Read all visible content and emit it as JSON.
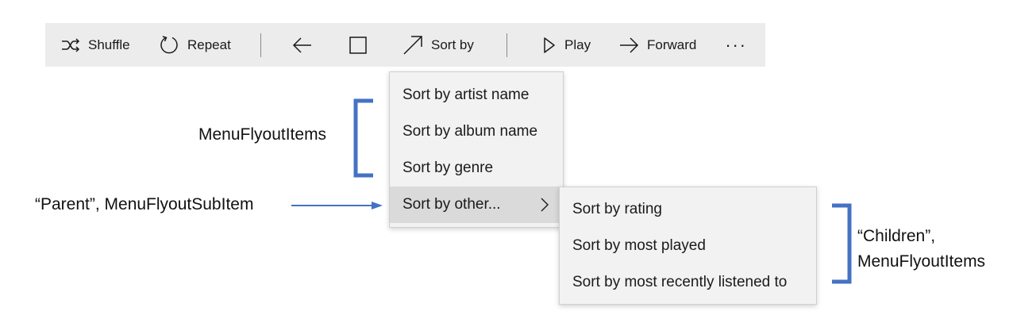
{
  "toolbar": {
    "shuffle_label": "Shuffle",
    "repeat_label": "Repeat",
    "sortby_label": "Sort by",
    "play_label": "Play",
    "forward_label": "Forward",
    "more_label": "..."
  },
  "flyout": {
    "items": [
      {
        "label": "Sort by artist name"
      },
      {
        "label": "Sort by album name"
      },
      {
        "label": "Sort by genre"
      },
      {
        "label": "Sort by other..."
      }
    ]
  },
  "submenu": {
    "items": [
      {
        "label": "Sort by rating"
      },
      {
        "label": "Sort by most played"
      },
      {
        "label": "Sort by most recently listened to"
      }
    ]
  },
  "annotations": {
    "menu_items": "MenuFlyoutItems",
    "parent": "“Parent”, MenuFlyoutSubItem",
    "children_line1": "“Children”,",
    "children_line2": "MenuFlyoutItems"
  },
  "colors": {
    "accent": "#4472c4",
    "toolbar_bg": "#ececec",
    "flyout_bg": "#f2f2f2",
    "hover_bg": "#dadada"
  }
}
